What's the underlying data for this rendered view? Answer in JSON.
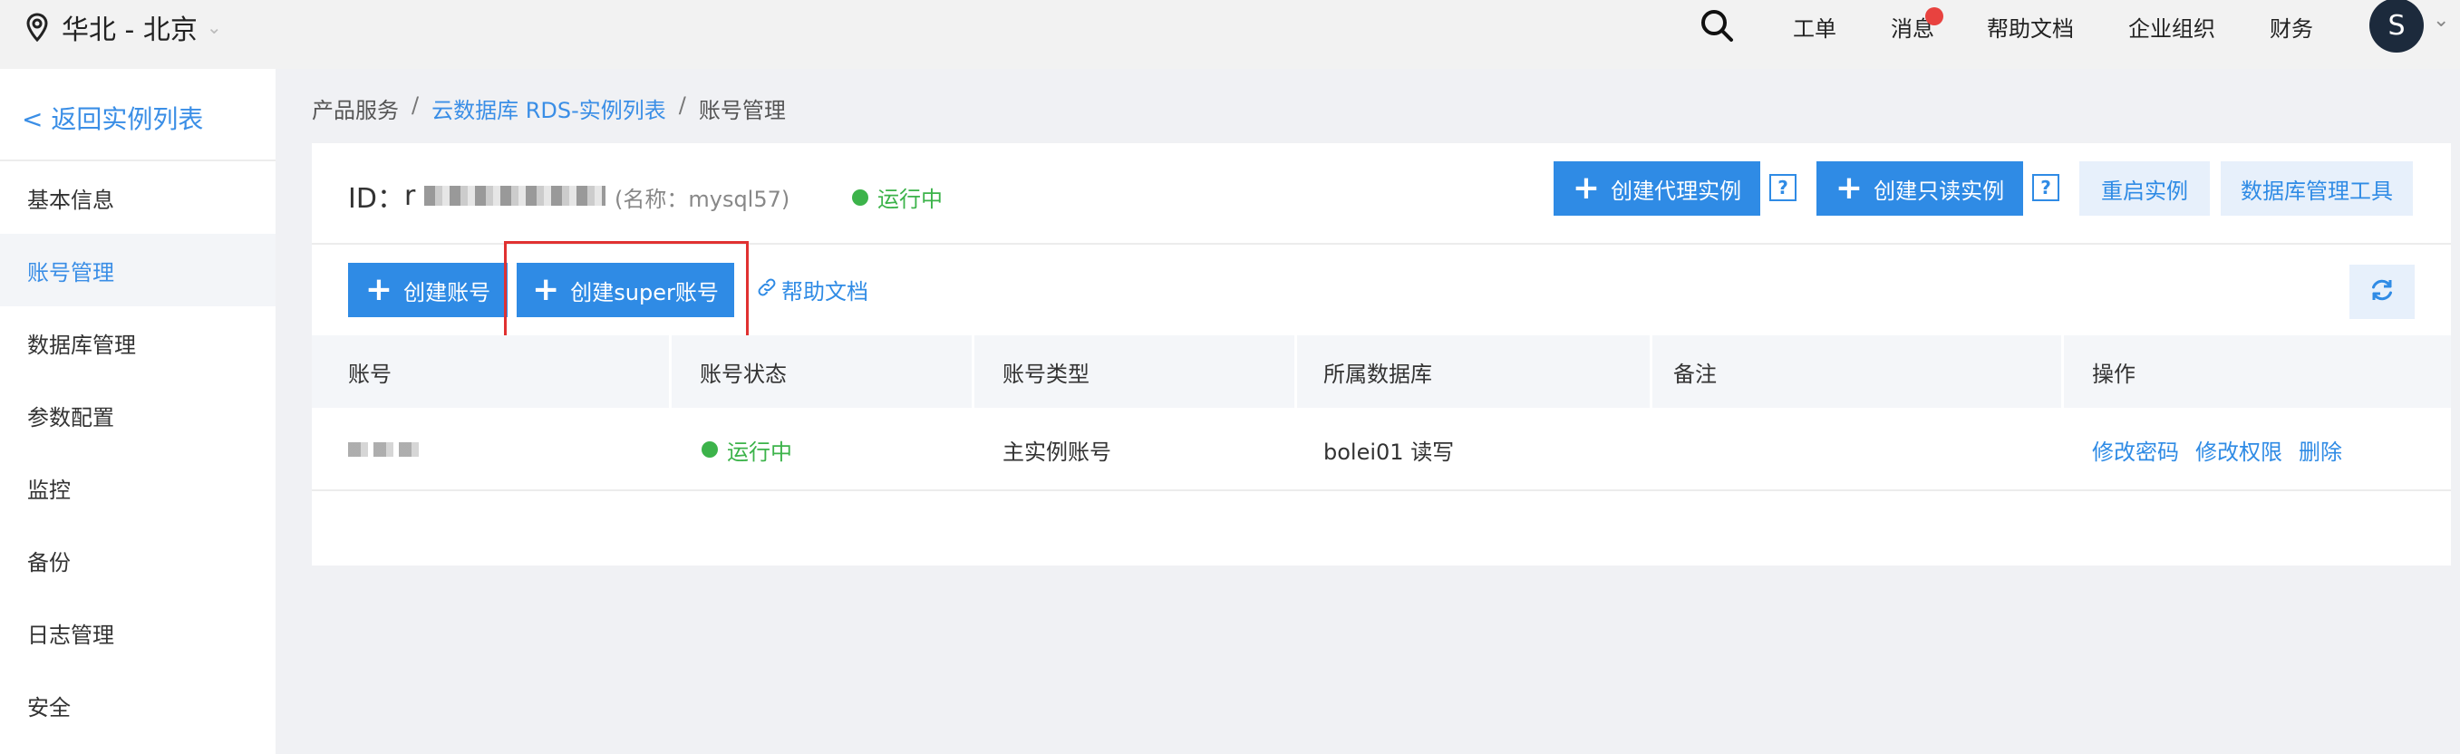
{
  "topbar": {
    "region": "华北 - 北京",
    "nav": [
      "工单",
      "消息",
      "帮助文档",
      "企业组织",
      "财务"
    ],
    "avatar_letter": "S"
  },
  "sidebar": {
    "back": "< 返回实例列表",
    "items": [
      "基本信息",
      "账号管理",
      "数据库管理",
      "参数配置",
      "监控",
      "备份",
      "日志管理",
      "安全"
    ],
    "active_index": 1
  },
  "breadcrumb": [
    "产品服务",
    "/",
    "云数据库 RDS-实例列表",
    "/",
    "账号管理"
  ],
  "instance": {
    "id_label": "ID：",
    "id_prefix": "r",
    "name": "(名称：mysql57)",
    "status": "运行中"
  },
  "actions": {
    "create_proxy": "创建代理实例",
    "create_readonly": "创建只读实例",
    "help_q": "?",
    "restart": "重启实例",
    "db_tool": "数据库管理工具",
    "create_account": "创建账号",
    "create_super": "创建super账号",
    "help_doc": "帮助文档"
  },
  "table": {
    "columns": [
      "账号",
      "账号状态",
      "账号类型",
      "所属数据库",
      "备注",
      "操作"
    ],
    "rows": [
      {
        "status": "运行中",
        "type": "主实例账号",
        "database": "bolei01 读写",
        "remark": "",
        "ops": [
          "修改密码",
          "修改权限",
          "删除"
        ]
      }
    ]
  },
  "colors": {
    "primary": "#2f8be5",
    "success": "#3cb34a",
    "highlight": "#e03131"
  }
}
